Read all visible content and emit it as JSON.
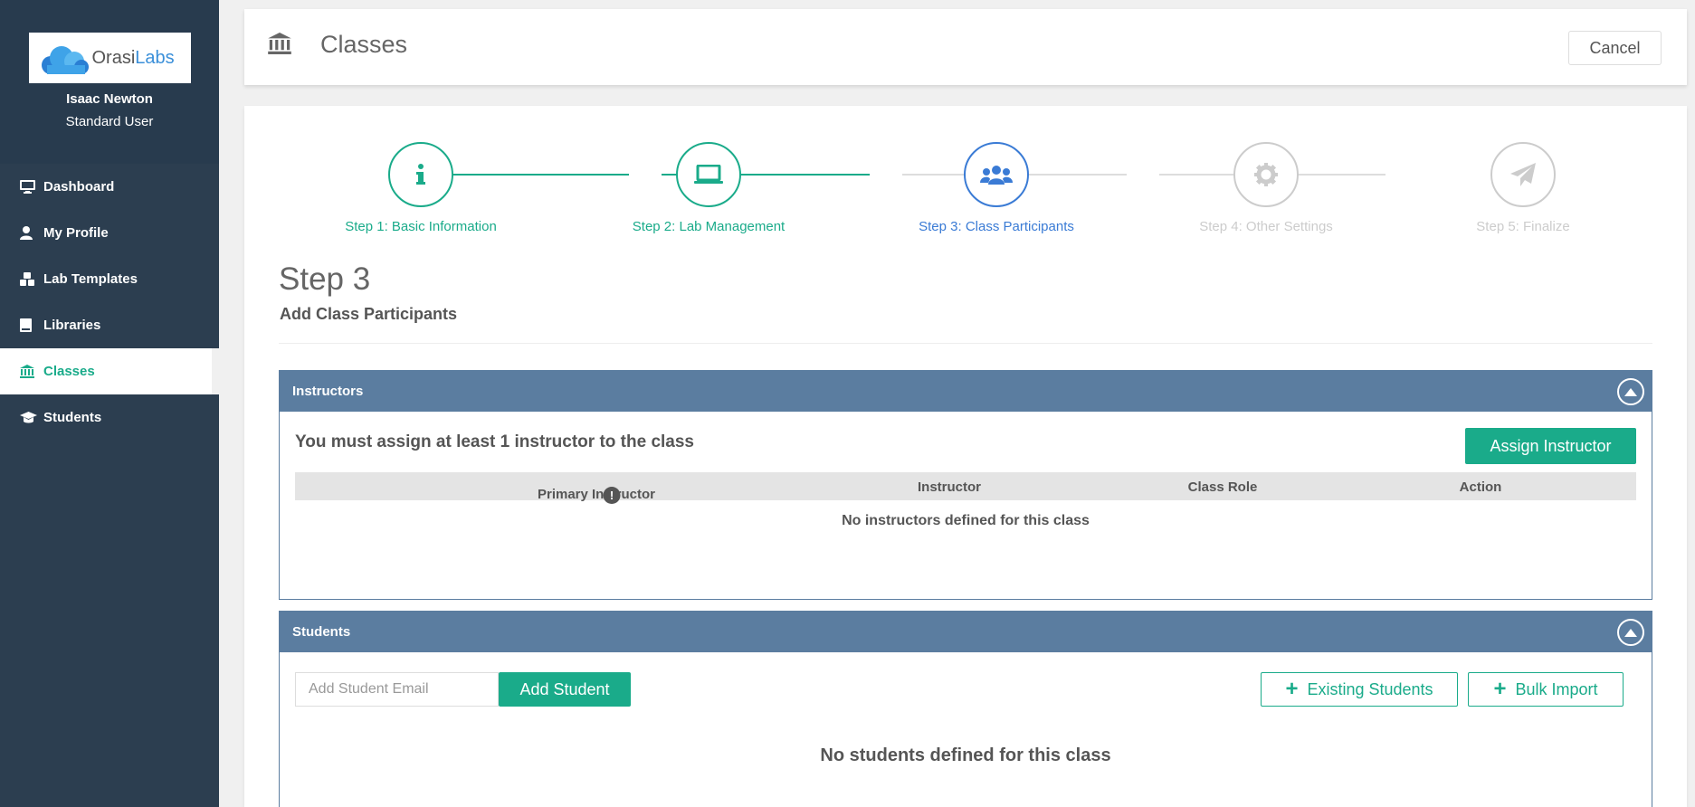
{
  "brand": {
    "logo_word": "Orasi",
    "logo_accent": "Labs"
  },
  "user": {
    "name": "Isaac Newton",
    "role": "Standard User"
  },
  "sidebar": {
    "items": [
      {
        "label": "Dashboard",
        "icon": "monitor-icon"
      },
      {
        "label": "My Profile",
        "icon": "user-icon"
      },
      {
        "label": "Lab Templates",
        "icon": "cubes-icon"
      },
      {
        "label": "Libraries",
        "icon": "book-icon"
      },
      {
        "label": "Classes",
        "icon": "bank-icon",
        "active": true
      },
      {
        "label": "Students",
        "icon": "graduation-cap-icon"
      }
    ]
  },
  "header": {
    "title": "Classes",
    "cancel_label": "Cancel"
  },
  "stepper": {
    "steps": [
      {
        "label": "Step 1: Basic Information",
        "icon": "info-icon",
        "state": "complete"
      },
      {
        "label": "Step 2: Lab Management",
        "icon": "laptop-icon",
        "state": "complete"
      },
      {
        "label": "Step 3: Class Participants",
        "icon": "users-icon",
        "state": "current"
      },
      {
        "label": "Step 4: Other Settings",
        "icon": "gear-icon",
        "state": "pending"
      },
      {
        "label": "Step 5: Finalize",
        "icon": "paper-plane-icon",
        "state": "pending"
      }
    ]
  },
  "step": {
    "heading": "Step 3",
    "subheading": "Add Class Participants"
  },
  "instructors": {
    "title": "Instructors",
    "message": "You must assign at least 1 instructor to the class",
    "assign_label": "Assign Instructor",
    "columns": [
      "Primary Instructor",
      "Instructor",
      "Class Role",
      "Action"
    ],
    "empty_text": "No instructors defined for this class"
  },
  "students": {
    "title": "Students",
    "email_placeholder": "Add Student Email",
    "add_label": "Add Student",
    "existing_label": "Existing Students",
    "bulk_label": "Bulk Import",
    "empty_text": "No students defined for this class"
  },
  "colors": {
    "accent": "#1aab8a",
    "current_step": "#3a7bd5",
    "sidebar_bg": "#2c3e50",
    "panel_header": "#5b7da0"
  }
}
